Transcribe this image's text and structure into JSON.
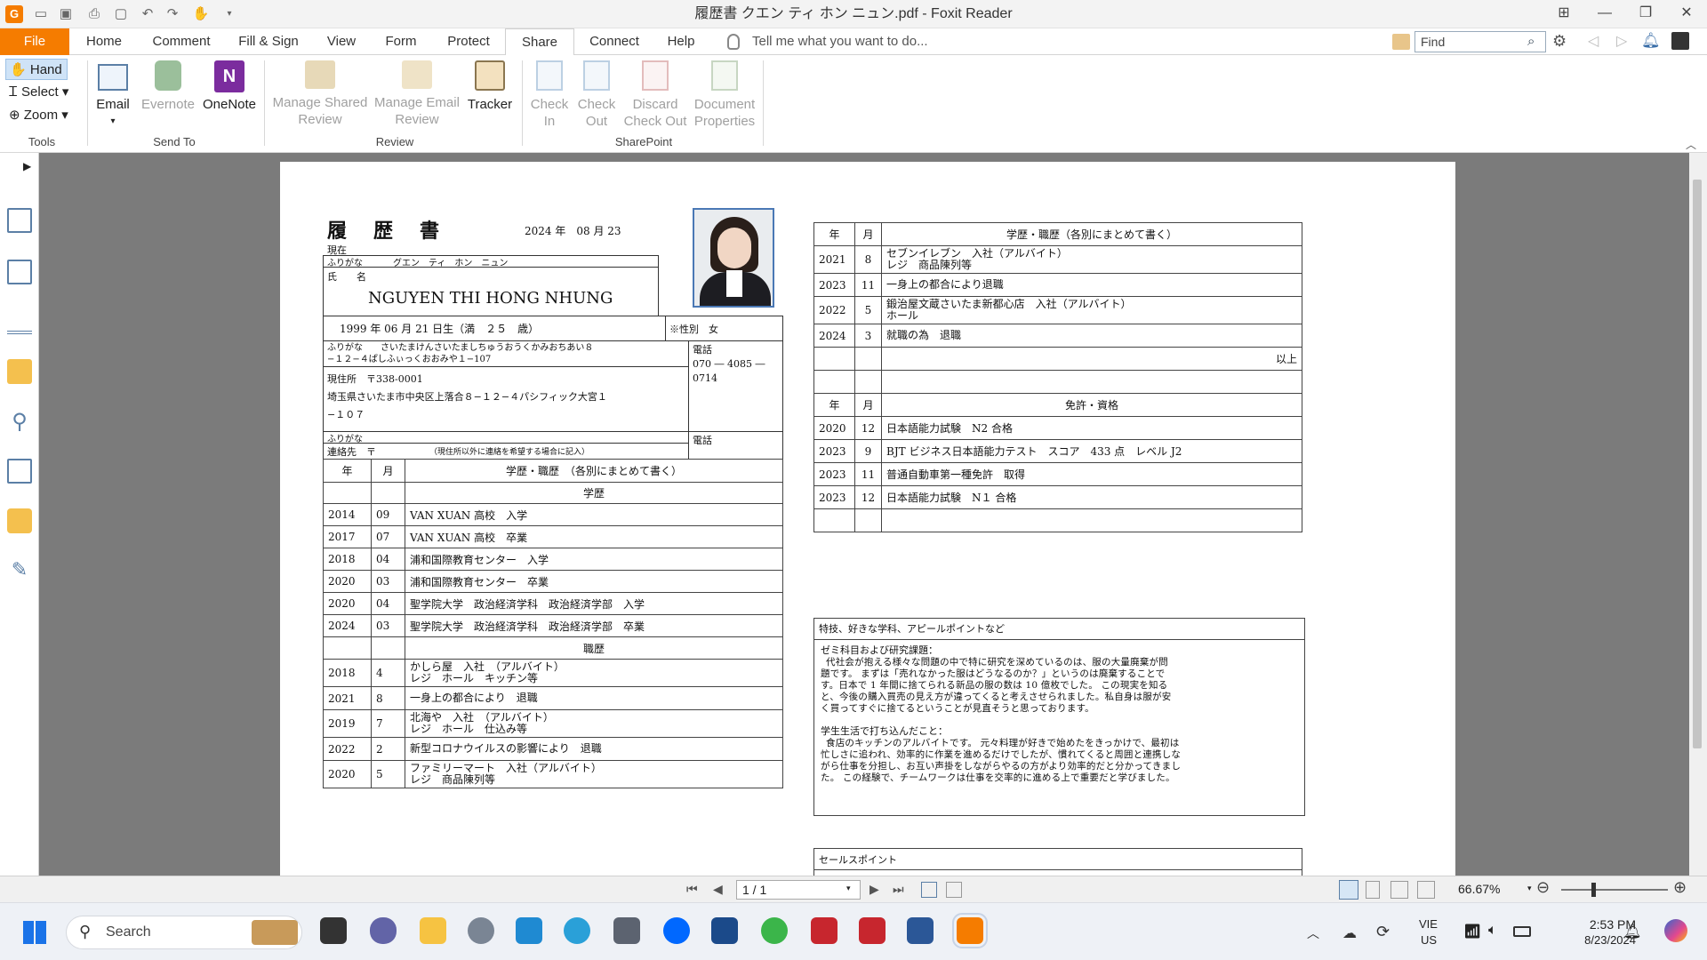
{
  "window": {
    "title": "履歴書 クエン ティ ホン ニュン.pdf - Foxit Reader"
  },
  "menu": {
    "file": "File",
    "tabs": [
      "Home",
      "Comment",
      "Fill & Sign",
      "View",
      "Form",
      "Protect",
      "Share",
      "Connect",
      "Help"
    ],
    "tell_me": "Tell me what you want to do...",
    "find_placeholder": "Find"
  },
  "ribbon": {
    "tools": {
      "hand": "Hand",
      "select": "Select",
      "zoom": "Zoom",
      "label": "Tools"
    },
    "send_to": {
      "email": "Email",
      "evernote": "Evernote",
      "onenote": "OneNote",
      "label": "Send To"
    },
    "review": {
      "manage_shared_1": "Manage Shared",
      "manage_shared_2": "Review",
      "manage_email_1": "Manage Email",
      "manage_email_2": "Review",
      "tracker": "Tracker",
      "label": "Review"
    },
    "sharepoint": {
      "check_in_1": "Check",
      "check_in_2": "In",
      "check_out_1": "Check",
      "check_out_2": "Out",
      "discard_1": "Discard",
      "discard_2": "Check Out",
      "docprops_1": "Document",
      "docprops_2": "Properties",
      "label": "SharePoint"
    }
  },
  "resume": {
    "title": "履　歴　書",
    "date": "2024 年　08 月 23",
    "current": "現在",
    "furigana_label": "ふりがな",
    "furigana_name": "グエン　ティ　ホン　ニュン",
    "name_label": "氏　　名",
    "name": "NGUYEN THI HONG NHUNG",
    "birth": "1999 年 06 月 21 日生（満　２５　歳）",
    "gender": "※性別　女",
    "addr_furigana_1": "ふりがな　　さいたまけんさいたましちゅうおうくかみおちあい８",
    "addr_furigana_2": "−１２−４ぱしふぃっくおおみや１−107",
    "phone_label": "電話",
    "phone_1": "070 ― 4085 ―",
    "phone_2": "0714",
    "address_label": "現住所　〒338-0001",
    "address_1": "埼玉県さいたま市中央区上落合８−１２−４パシフィック大宮１",
    "address_2": "−１０７",
    "contact_furigana": "ふりがな",
    "contact_phone": "電話",
    "contact_label": "連絡先　〒",
    "contact_note": "（現住所以外に連絡を希望する場合に記入）",
    "col_year": "年",
    "col_month": "月",
    "col_history": "学歴・職歴　（各別にまとめて書く）",
    "edu_header": "学歴",
    "work_header": "職歴",
    "education": [
      {
        "y": "2014",
        "m": "09",
        "t": "VAN XUAN 高校　入学"
      },
      {
        "y": "2017",
        "m": "07",
        "t": "VAN XUAN 高校　卒業"
      },
      {
        "y": "2018",
        "m": "04",
        "t": "浦和国際教育センター　入学"
      },
      {
        "y": "2020",
        "m": "03",
        "t": "浦和国際教育センター　卒業"
      },
      {
        "y": "2020",
        "m": "04",
        "t": "聖学院大学　政治経済学科　政治経済学部　入学"
      },
      {
        "y": "2024",
        "m": "03",
        "t": "聖学院大学　政治経済学科　政治経済学部　卒業"
      }
    ],
    "work": [
      {
        "y": "2018",
        "m": "4",
        "t": "かしら屋　入社　（アルバイト）",
        "t2": "レジ　ホール　キッチン等"
      },
      {
        "y": "2021",
        "m": "8",
        "t": "一身上の都合により　退職",
        "t2": ""
      },
      {
        "y": "2019",
        "m": "7",
        "t": "北海や　入社　（アルバイト）",
        "t2": "レジ　ホール　仕込み等"
      },
      {
        "y": "2022",
        "m": "2",
        "t": "新型コロナウイルスの影響により　退職",
        "t2": ""
      },
      {
        "y": "2020",
        "m": "5",
        "t": "ファミリーマート　入社（アルバイト）",
        "t2": "レジ　商品陳列等"
      }
    ],
    "right_history_header": "学歴・職歴（各別にまとめて書く）",
    "right_history": [
      {
        "y": "2021",
        "m": "8",
        "t": "セブンイレブン　入社（アルバイト）",
        "t2": "レジ　商品陳列等"
      },
      {
        "y": "2023",
        "m": "11",
        "t": "一身上の都合により退職",
        "t2": ""
      },
      {
        "y": "2022",
        "m": "5",
        "t": "鍛治屋文蔵さいたま新都心店　入社（アルバイト）",
        "t2": "ホール"
      },
      {
        "y": "2024",
        "m": "3",
        "t": "就職の為　退職",
        "t2": ""
      }
    ],
    "end_mark": "以上",
    "license_header": "免許・資格",
    "licenses": [
      {
        "y": "2020",
        "m": "12",
        "t": "日本語能力試験　N2 合格"
      },
      {
        "y": "2023",
        "m": "9",
        "t": "BJT ビジネス日本語能力テスト　スコア　433 点　レベル J2"
      },
      {
        "y": "2023",
        "m": "11",
        "t": "普通自動車第一種免許　取得"
      },
      {
        "y": "2023",
        "m": "12",
        "t": "日本語能力試験　N１ 合格"
      }
    ],
    "special_header": "特技、好きな学科、アピールポイントなど",
    "seminar_title": "ゼミ科目および研究課題：",
    "seminar_lines": [
      "代社会が抱える様々な問題の中で特に研究を深めているのは、服の大量廃棄が問",
      "題です。 まずは「売れなかった服はどうなるのか？」というのは廃棄することで",
      "す。日本で 1 年間に捨てられる新品の服の数は 10 億枚でした。 この現実を知る",
      "と、今後の購入買売の見え方が違ってくると考えさせられました。私自身は服が安",
      "く買ってすぐに捨てるということが見直そうと思っております。"
    ],
    "student_title": "学生生活で打ち込んだこと：",
    "student_lines": [
      "食店のキッチンのアルバイトです。 元々料理が好きで始めたをきっかけで、最初は",
      "忙しさに追われ、効率的に作業を進めるだけでしたが、慣れてくると周囲と連携しな",
      "がら仕事を分担し、お互い声掛をしながらやるの方がより効率的だと分かってきまし",
      "た。 この経験で、チームワークは仕事を交率的に進める上で重要だと学びました。"
    ],
    "sales_header": "セールスポイント"
  },
  "status": {
    "page": "1 / 1",
    "zoom": "66.67%"
  },
  "taskbar": {
    "search": "Search",
    "lang_1": "VIE",
    "lang_2": "US",
    "time": "2:53 PM",
    "date": "8/23/2024"
  }
}
